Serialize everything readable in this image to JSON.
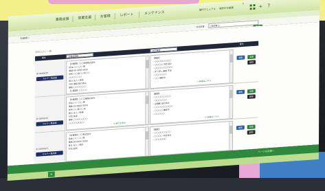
{
  "nav": {
    "items": [
      "業務支援",
      "営業支援",
      "お客様",
      "レポート",
      "メンテナンス"
    ],
    "header_links": [
      "操作マニュアル",
      "操作中の画面"
    ],
    "counter": "0",
    "help_icon": "?",
    "plus_icon": "+"
  },
  "subbar": {
    "back_link": "前画面へ",
    "dropdown_label": "担当部署",
    "dropdown_value": "(指定無し)",
    "action_button": "登録"
  },
  "breadcrumb": "対応入力 / 一覧",
  "table_header": {
    "left": "案件",
    "col1": "お客様情報",
    "col2": "対応履歴",
    "right": "操作"
  },
  "rows": [
    {
      "id_label": "ID 0000025",
      "detail_button": "カルテ一覧画面",
      "panel1_lines": [
        "【お客様】〇〇商事株式会社",
        "担当:〇〇 〇〇 様",
        "電話:00-0000-0000",
        "住所:〇〇県〇〇市〇〇",
        "〇〇〇〇-〇〇",
        "区分:法人 / 既存",
        "対応:電話 受付済み",
        "備考:〇〇〇〇〇〇",
        "【ご要望】〇〇〇〇"
      ],
      "panel2_lines": [
        "【履歴】",
        "・〇〇〇〇〇〇〇〇",
        "・〇〇〇〇 対応済み",
        "・〇〇〇〇〇〇〇〇〇",
        "・折り返し連絡 予定",
        "・〇〇〇〇〇〇",
        "・〇〇 確認中"
      ],
      "panel2_link": "→ 詳細はこちら",
      "buttons": [
        "編集",
        "変更",
        "削除"
      ]
    },
    {
      "id_label": "ID 0000024",
      "detail_button": "カルテ一覧画面",
      "panel1_lines": [
        "【お客様】〇〇工業株式会社",
        "担当:〇〇 〇〇 様",
        "電話:00-0000-0000",
        "住所:〇〇県〇〇市",
        "区分:法人 / 新規",
        "対応:来店",
        "備考:〇〇〇〇〇〇〇",
        "〇〇〇〇〇〇〇〇"
      ],
      "panel1_link": "▸ 続きを表示",
      "panel2_lines": [
        "【履歴】",
        "・〇〇〇〇〇〇〇〇",
        "・〇〇〇〇〇〇",
        "・見積書 送付済み",
        "・〇〇〇〇〇〇〇〇〇",
        "・〇〇〇〇 確認中",
        "・〇〇〇〇〇"
      ],
      "panel2_link": "→ 詳細はこちら",
      "buttons": [
        "編集",
        "変更",
        "削除"
      ]
    },
    {
      "id_label": "ID 0000023",
      "detail_button": "カルテ一覧画面",
      "panel1_lines": [
        "【お客様】〇〇株式会社",
        "担当:〇〇 〇〇 様",
        "電話:00-0000-0000",
        "区分:法人 / 既存",
        "対応:訪問"
      ],
      "panel2_lines": [
        "【履歴】",
        "・〇〇〇〇〇〇〇〇",
        "・〇〇〇〇 対応済み",
        "・〇〇〇〇〇〇"
      ],
      "buttons": [
        "編集",
        "変更",
        "削除"
      ]
    }
  ],
  "footer": {
    "text": "ページの先頭へ",
    "bottom_button": "≡"
  }
}
